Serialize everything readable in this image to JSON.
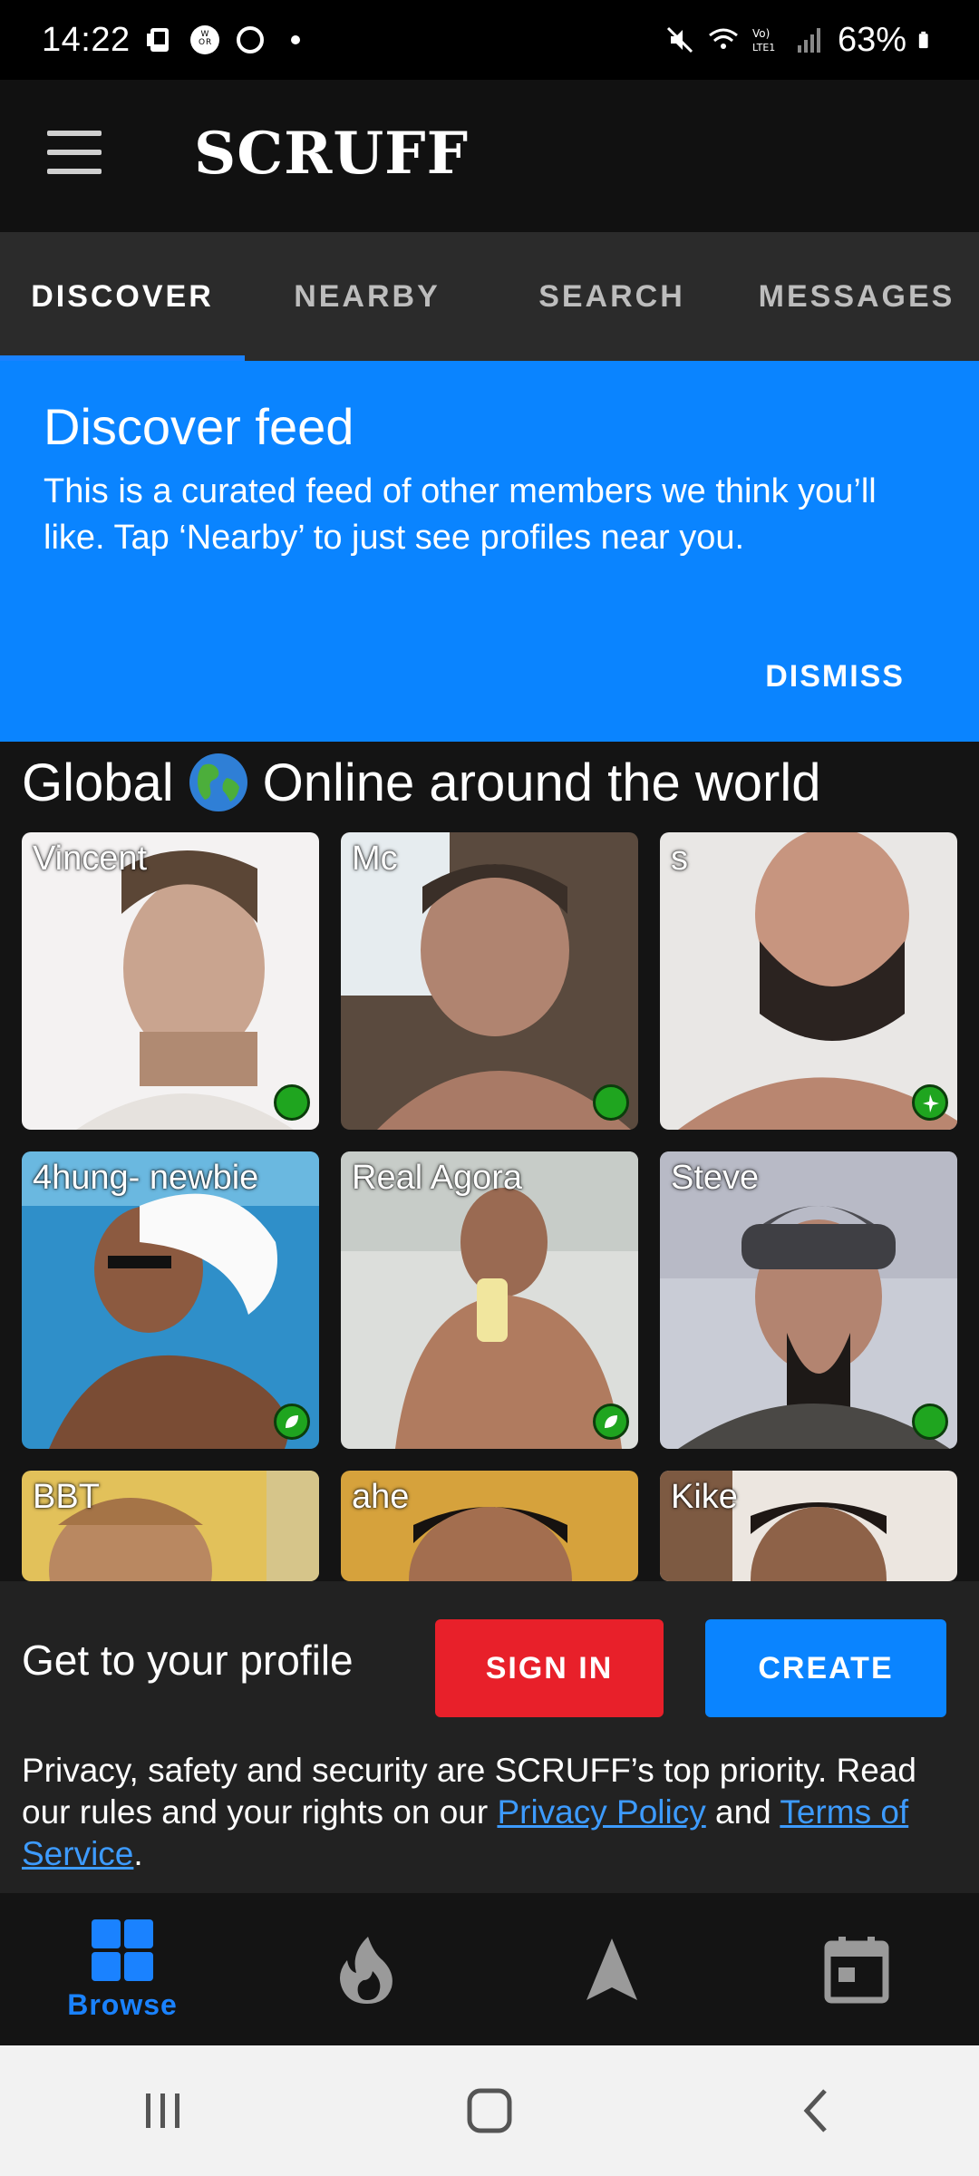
{
  "status_bar": {
    "time": "14:22",
    "battery": "63%",
    "icons": [
      "phone-icon",
      "wor-icon",
      "circle-icon",
      "dot-icon",
      "mute-icon",
      "wifi-icon",
      "volte-icon",
      "signal-icon",
      "battery-icon"
    ],
    "volte_label": "Vo)\nLTE1"
  },
  "header": {
    "logo": "SCRUFF",
    "menu_icon": "hamburger-icon"
  },
  "tabs": [
    {
      "label": "DISCOVER",
      "active": true
    },
    {
      "label": "NEARBY",
      "active": false
    },
    {
      "label": "SEARCH",
      "active": false
    },
    {
      "label": "MESSAGES",
      "active": false
    }
  ],
  "banner": {
    "title": "Discover feed",
    "text": "This is a curated feed of other members we think you’ll like. Tap ‘Nearby’ to just see profiles near you.",
    "dismiss": "DISMISS",
    "color": "#0a84ff"
  },
  "section": {
    "title_prefix": "Global",
    "title_suffix": "Online around the world",
    "icon": "globe-icon"
  },
  "profiles": [
    {
      "name": "Vincent",
      "status": "online",
      "bg": "#d9d3cf"
    },
    {
      "name": "Mc",
      "status": "online",
      "bg": "#7a6a5c"
    },
    {
      "name": "s",
      "status": "travel",
      "bg": "#b3958a"
    },
    {
      "name": "4hung- newbie",
      "status": "eco",
      "bg": "#2d82b8"
    },
    {
      "name": "Real Agora",
      "status": "eco",
      "bg": "#b88e74"
    },
    {
      "name": "Steve",
      "status": "online",
      "bg": "#6b6a78"
    },
    {
      "name": "BBT",
      "status": "",
      "bg": "#c49a74"
    },
    {
      "name": "ahe",
      "status": "",
      "bg": "#c99a3d"
    },
    {
      "name": "Kike",
      "status": "",
      "bg": "#8a7566"
    }
  ],
  "profile_panel": {
    "heading": "Get to your profile",
    "signin": "SIGN IN",
    "create": "CREATE",
    "privacy_text_1": "Privacy, safety and security are SCRUFF’s top priority. Read our rules and your rights on our ",
    "privacy_link": "Privacy Policy",
    "privacy_text_2": " and ",
    "terms_link": "Terms of Service",
    "privacy_text_3": "."
  },
  "bottom_nav": [
    {
      "label": "Browse",
      "icon": "grid-icon",
      "active": true
    },
    {
      "label": "",
      "icon": "flame-icon",
      "active": false
    },
    {
      "label": "",
      "icon": "navigation-arrow-icon",
      "active": false
    },
    {
      "label": "",
      "icon": "calendar-icon",
      "active": false
    }
  ],
  "colors": {
    "accent": "#0a84ff",
    "signin": "#e8202a",
    "online": "#1fa51f"
  }
}
